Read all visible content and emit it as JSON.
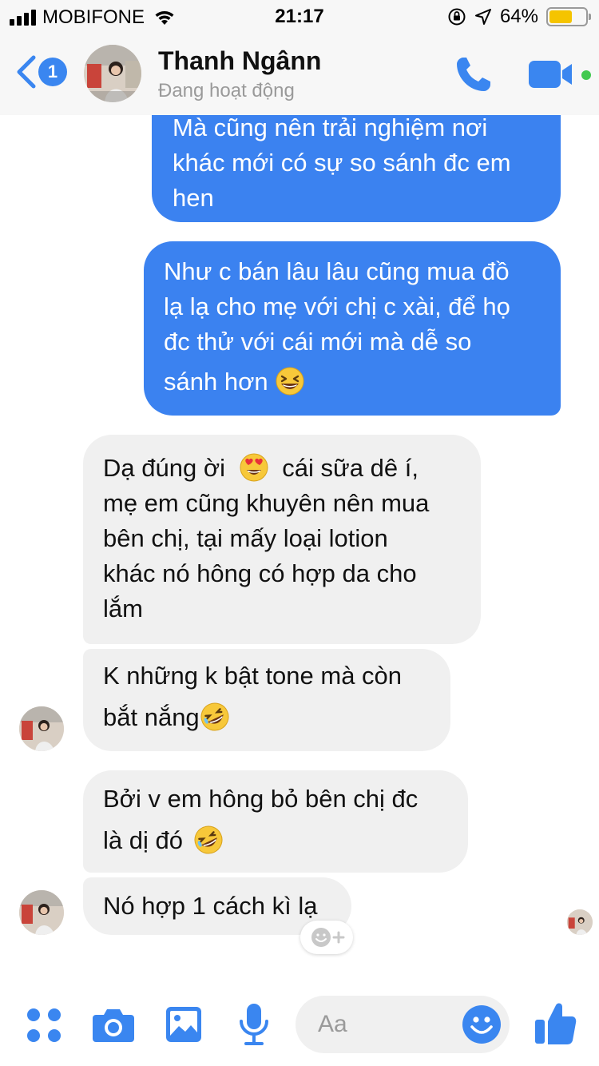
{
  "status_bar": {
    "carrier": "MOBIFONE",
    "time": "21:17",
    "battery_percent": "64%",
    "battery_level": 0.64
  },
  "header": {
    "back_count": "1",
    "contact_name": "Thanh Ngânn",
    "contact_status": "Đang hoạt động"
  },
  "messages": [
    {
      "direction": "sent",
      "lines": [
        "Mà cũng nên trải nghiệm nơi",
        "khác mới có sự so sánh đc em",
        "hen"
      ]
    },
    {
      "direction": "sent",
      "lines": [
        "Như c bán lâu lâu cũng mua đồ",
        "lạ lạ cho mẹ với chị c xài, để họ",
        "đc thử với cái mới mà dễ so",
        "sánh hơn"
      ],
      "emoji": "laughing-emoji"
    },
    {
      "direction": "received",
      "line1_start": "Dạ đúng ời",
      "line1_end": "cái sữa dê í,",
      "emoji": "heart-eyes-emoji",
      "lines": [
        "mẹ em cũng khuyên nên mua",
        "bên chị, tại mấy loại lotion",
        "khác nó hông có hợp da cho",
        "lắm"
      ]
    },
    {
      "direction": "received",
      "lines": [
        "K những k bật tone mà còn",
        "bắt nắng"
      ],
      "emoji": "rofl-emoji"
    },
    {
      "direction": "received",
      "lines": [
        "Bởi v em hông bỏ bên chị đc",
        "là dị đó"
      ],
      "emoji": "rofl-emoji"
    },
    {
      "direction": "received",
      "lines": [
        "Nó hợp 1 cách kì lạ"
      ]
    }
  ],
  "composer": {
    "placeholder": "Aa"
  },
  "colors": {
    "sent_bubble": "#3b82f0",
    "received_bubble": "#f0f0f0",
    "accent": "#3a86f0",
    "online": "#42c94f"
  }
}
